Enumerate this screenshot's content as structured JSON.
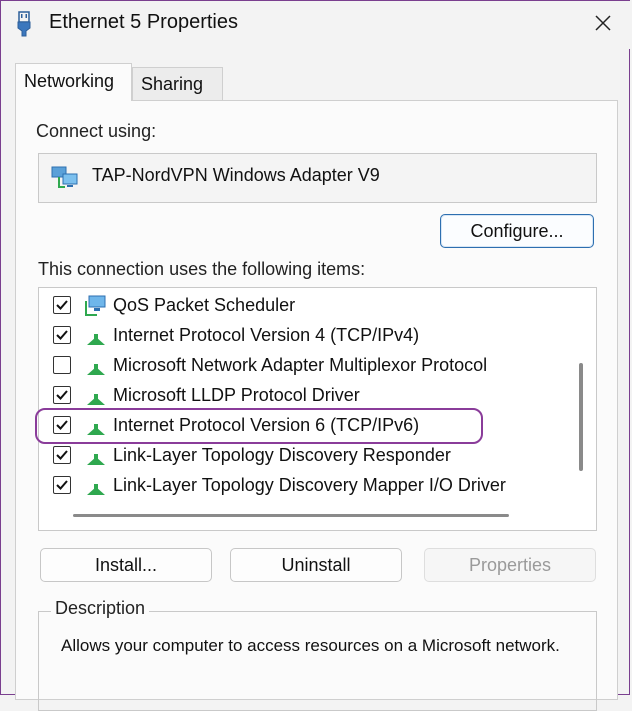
{
  "window": {
    "title": "Ethernet 5 Properties",
    "close_glyph": "✕"
  },
  "tabs": [
    {
      "label": "Networking",
      "active": true
    },
    {
      "label": "Sharing",
      "active": false
    }
  ],
  "connect": {
    "label": "Connect using:",
    "adapter_name": "TAP-NordVPN Windows Adapter V9",
    "adapter_icon": "network-adapter-icon",
    "configure_label": "Configure..."
  },
  "items_section": {
    "label": "This connection uses the following items:",
    "items": [
      {
        "label": "QoS Packet Scheduler",
        "checked": true,
        "icon": "network-computer-icon"
      },
      {
        "label": "Internet Protocol Version 4 (TCP/IPv4)",
        "checked": true,
        "icon": "protocol-icon"
      },
      {
        "label": "Microsoft Network Adapter Multiplexor Protocol",
        "checked": false,
        "icon": "protocol-icon"
      },
      {
        "label": "Microsoft LLDP Protocol Driver",
        "checked": true,
        "icon": "protocol-icon"
      },
      {
        "label": "Internet Protocol Version 6 (TCP/IPv6)",
        "checked": true,
        "icon": "protocol-icon",
        "highlighted": true
      },
      {
        "label": "Link-Layer Topology Discovery Responder",
        "checked": true,
        "icon": "protocol-icon"
      },
      {
        "label": "Link-Layer Topology Discovery Mapper I/O Driver",
        "checked": true,
        "icon": "protocol-icon"
      }
    ]
  },
  "actions": {
    "install_label": "Install...",
    "uninstall_label": "Uninstall",
    "properties_label": "Properties"
  },
  "description": {
    "legend": "Description",
    "text": "Allows your computer to access resources on a Microsoft network."
  },
  "colors": {
    "accent": "#2d6fb0",
    "highlight_ring": "#8a3c9a",
    "protocol_green": "#2fa84f"
  }
}
